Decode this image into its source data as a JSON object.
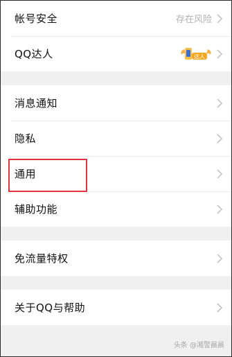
{
  "settings": {
    "group1": [
      {
        "label": "帐号安全",
        "status": "存在风险"
      },
      {
        "label": "QQ达人",
        "badge_text": "达人"
      }
    ],
    "group2": [
      {
        "label": "消息通知"
      },
      {
        "label": "隐私"
      },
      {
        "label": "通用"
      },
      {
        "label": "辅助功能"
      }
    ],
    "group3": [
      {
        "label": "免流量特权"
      }
    ],
    "group4": [
      {
        "label": "关于QQ与帮助"
      }
    ]
  },
  "watermark": "头条 @湘警晨晨",
  "colors": {
    "highlight_border": "#d9363e",
    "chevron": "#c4c4c4",
    "badge": "#f5a623"
  }
}
